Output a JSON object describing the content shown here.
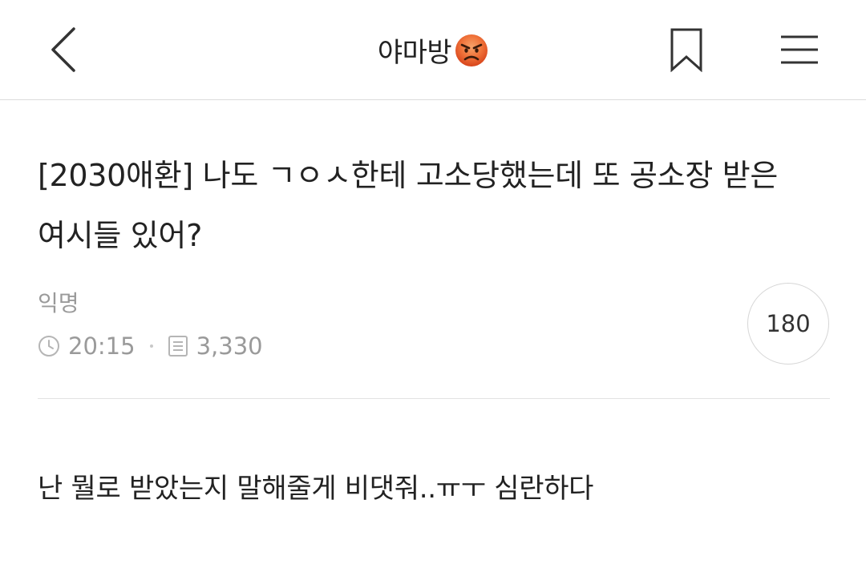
{
  "header": {
    "board_name": "야마방",
    "board_emoji_icon": "angry-face-icon",
    "back_icon": "chevron-left-icon",
    "bookmark_icon": "bookmark-icon",
    "menu_icon": "hamburger-menu-icon"
  },
  "post": {
    "title": "[2030애환] 나도 ㄱㅇㅅ한테 고소당했는데 또 공소장 받은 여시들 있어?",
    "author": "익명",
    "time": "20:15",
    "views": "3,330",
    "comment_count": "180",
    "body": "난 뭘로 받았는지 말해줄게 비댓줘..ㅠㅜ 심란하다"
  },
  "colors": {
    "text": "#222222",
    "meta": "#9a9a9a",
    "divider": "#e2e2e2"
  }
}
